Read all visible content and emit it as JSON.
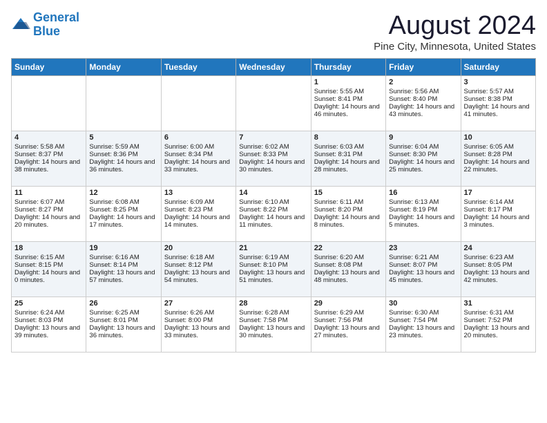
{
  "header": {
    "logo_line1": "General",
    "logo_line2": "Blue",
    "month_title": "August 2024",
    "location": "Pine City, Minnesota, United States"
  },
  "weekdays": [
    "Sunday",
    "Monday",
    "Tuesday",
    "Wednesday",
    "Thursday",
    "Friday",
    "Saturday"
  ],
  "weeks": [
    [
      {
        "day": "",
        "info": ""
      },
      {
        "day": "",
        "info": ""
      },
      {
        "day": "",
        "info": ""
      },
      {
        "day": "",
        "info": ""
      },
      {
        "day": "1",
        "info": "Sunrise: 5:55 AM\nSunset: 8:41 PM\nDaylight: 14 hours and 46 minutes."
      },
      {
        "day": "2",
        "info": "Sunrise: 5:56 AM\nSunset: 8:40 PM\nDaylight: 14 hours and 43 minutes."
      },
      {
        "day": "3",
        "info": "Sunrise: 5:57 AM\nSunset: 8:38 PM\nDaylight: 14 hours and 41 minutes."
      }
    ],
    [
      {
        "day": "4",
        "info": "Sunrise: 5:58 AM\nSunset: 8:37 PM\nDaylight: 14 hours and 38 minutes."
      },
      {
        "day": "5",
        "info": "Sunrise: 5:59 AM\nSunset: 8:36 PM\nDaylight: 14 hours and 36 minutes."
      },
      {
        "day": "6",
        "info": "Sunrise: 6:00 AM\nSunset: 8:34 PM\nDaylight: 14 hours and 33 minutes."
      },
      {
        "day": "7",
        "info": "Sunrise: 6:02 AM\nSunset: 8:33 PM\nDaylight: 14 hours and 30 minutes."
      },
      {
        "day": "8",
        "info": "Sunrise: 6:03 AM\nSunset: 8:31 PM\nDaylight: 14 hours and 28 minutes."
      },
      {
        "day": "9",
        "info": "Sunrise: 6:04 AM\nSunset: 8:30 PM\nDaylight: 14 hours and 25 minutes."
      },
      {
        "day": "10",
        "info": "Sunrise: 6:05 AM\nSunset: 8:28 PM\nDaylight: 14 hours and 22 minutes."
      }
    ],
    [
      {
        "day": "11",
        "info": "Sunrise: 6:07 AM\nSunset: 8:27 PM\nDaylight: 14 hours and 20 minutes."
      },
      {
        "day": "12",
        "info": "Sunrise: 6:08 AM\nSunset: 8:25 PM\nDaylight: 14 hours and 17 minutes."
      },
      {
        "day": "13",
        "info": "Sunrise: 6:09 AM\nSunset: 8:23 PM\nDaylight: 14 hours and 14 minutes."
      },
      {
        "day": "14",
        "info": "Sunrise: 6:10 AM\nSunset: 8:22 PM\nDaylight: 14 hours and 11 minutes."
      },
      {
        "day": "15",
        "info": "Sunrise: 6:11 AM\nSunset: 8:20 PM\nDaylight: 14 hours and 8 minutes."
      },
      {
        "day": "16",
        "info": "Sunrise: 6:13 AM\nSunset: 8:19 PM\nDaylight: 14 hours and 5 minutes."
      },
      {
        "day": "17",
        "info": "Sunrise: 6:14 AM\nSunset: 8:17 PM\nDaylight: 14 hours and 3 minutes."
      }
    ],
    [
      {
        "day": "18",
        "info": "Sunrise: 6:15 AM\nSunset: 8:15 PM\nDaylight: 14 hours and 0 minutes."
      },
      {
        "day": "19",
        "info": "Sunrise: 6:16 AM\nSunset: 8:14 PM\nDaylight: 13 hours and 57 minutes."
      },
      {
        "day": "20",
        "info": "Sunrise: 6:18 AM\nSunset: 8:12 PM\nDaylight: 13 hours and 54 minutes."
      },
      {
        "day": "21",
        "info": "Sunrise: 6:19 AM\nSunset: 8:10 PM\nDaylight: 13 hours and 51 minutes."
      },
      {
        "day": "22",
        "info": "Sunrise: 6:20 AM\nSunset: 8:08 PM\nDaylight: 13 hours and 48 minutes."
      },
      {
        "day": "23",
        "info": "Sunrise: 6:21 AM\nSunset: 8:07 PM\nDaylight: 13 hours and 45 minutes."
      },
      {
        "day": "24",
        "info": "Sunrise: 6:23 AM\nSunset: 8:05 PM\nDaylight: 13 hours and 42 minutes."
      }
    ],
    [
      {
        "day": "25",
        "info": "Sunrise: 6:24 AM\nSunset: 8:03 PM\nDaylight: 13 hours and 39 minutes."
      },
      {
        "day": "26",
        "info": "Sunrise: 6:25 AM\nSunset: 8:01 PM\nDaylight: 13 hours and 36 minutes."
      },
      {
        "day": "27",
        "info": "Sunrise: 6:26 AM\nSunset: 8:00 PM\nDaylight: 13 hours and 33 minutes."
      },
      {
        "day": "28",
        "info": "Sunrise: 6:28 AM\nSunset: 7:58 PM\nDaylight: 13 hours and 30 minutes."
      },
      {
        "day": "29",
        "info": "Sunrise: 6:29 AM\nSunset: 7:56 PM\nDaylight: 13 hours and 27 minutes."
      },
      {
        "day": "30",
        "info": "Sunrise: 6:30 AM\nSunset: 7:54 PM\nDaylight: 13 hours and 23 minutes."
      },
      {
        "day": "31",
        "info": "Sunrise: 6:31 AM\nSunset: 7:52 PM\nDaylight: 13 hours and 20 minutes."
      }
    ]
  ]
}
